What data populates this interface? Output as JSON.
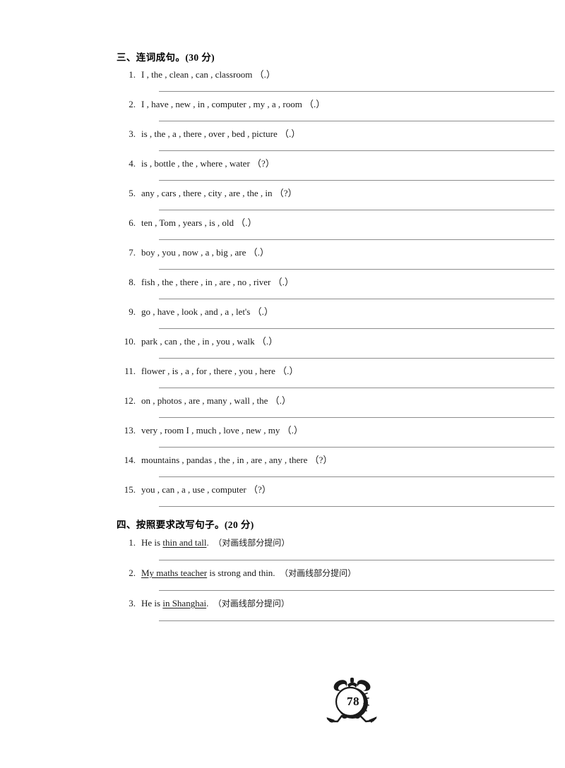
{
  "page": {
    "number": "78",
    "footer_icon": "alarm-clock-icon"
  },
  "sections": [
    {
      "id": "section-three",
      "heading": "三、连词成句。(30 分)",
      "heading_label": "三、连词成句。",
      "score": "(30 分)",
      "items": [
        {
          "num": "1.",
          "text": "I , the , clean , can , classroom （.）"
        },
        {
          "num": "2.",
          "text": "I , have , new , in , computer , my , a , room （.）"
        },
        {
          "num": "3.",
          "text": "is , the , a , there , over , bed , picture （.）"
        },
        {
          "num": "4.",
          "text": "is , bottle , the , where , water （?）"
        },
        {
          "num": "5.",
          "text": "any , cars , there , city , are , the ,  in （?）"
        },
        {
          "num": "6.",
          "text": "ten , Tom , years , is , old （.）"
        },
        {
          "num": "7.",
          "text": "boy , you , now , a , big , are （.）"
        },
        {
          "num": "8.",
          "text": "fish , the , there , in , are , no , river （.）"
        },
        {
          "num": "9.",
          "text": "go , have , look , and , a , let's （.）"
        },
        {
          "num": "10.",
          "text": "park , can , the , in , you , walk （.）"
        },
        {
          "num": "11.",
          "text": "flower , is , a , for , there , you , here （.）"
        },
        {
          "num": "12.",
          "text": "on , photos , are , many , wall , the （.）"
        },
        {
          "num": "13.",
          "text": "very , room I , much , love , new , my （.）"
        },
        {
          "num": "14.",
          "text": "mountains , pandas , the , in , are , any , there （?）"
        },
        {
          "num": "15.",
          "text": "you , can , a , use , computer （?）"
        }
      ]
    },
    {
      "id": "section-four",
      "heading": "四、按照要求改写句子。(20 分)",
      "heading_label": "四、按照要求改写句子。",
      "score": "(20 分)",
      "items": [
        {
          "num": "1.",
          "before": "He is ",
          "underlined": "thin and tall",
          "after": ".",
          "instruction": "（对画线部分提问）"
        },
        {
          "num": "2.",
          "before": "",
          "underlined": "My maths teacher",
          "after": " is strong and thin.",
          "instruction": "（对画线部分提问）"
        },
        {
          "num": "3.",
          "before": "He is ",
          "underlined": "in Shanghai",
          "after": ".",
          "instruction": "（对画线部分提问）"
        }
      ]
    }
  ]
}
